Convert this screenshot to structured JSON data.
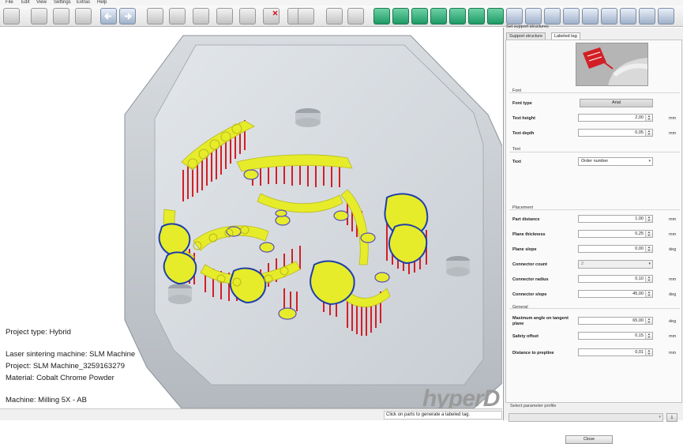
{
  "menu": [
    "File",
    "Edit",
    "View",
    "Settings",
    "Extras",
    "Help"
  ],
  "toolbar": {
    "left_buttons": [
      "open-icon",
      "save-icon",
      "print-icon",
      "back-arrow-icon",
      "forward-arrow-icon",
      "part-icon",
      "part-icon",
      "part-icon",
      "part-icon",
      "delete-part-icon",
      "part-icon",
      "part-icon",
      "measure-icon",
      "part-icon"
    ],
    "right_buttons": [
      "view-front-icon",
      "view-back-icon",
      "view-left-icon",
      "view-right-icon",
      "view-top-icon",
      "view-bottom-icon",
      "view-iso-icon",
      "tool-icon",
      "tool-icon",
      "tool-icon",
      "tool-icon",
      "tool-icon",
      "tool-icon",
      "tool-icon",
      "tool-icon"
    ]
  },
  "viewport": {
    "info": {
      "project_type": "Project type: Hybrid",
      "machine": "Laser sintering machine: SLM Machine",
      "project": "Project: SLM Machine_3259163279",
      "material": "Material: Cobalt Chrome Powder",
      "milling": "Machine: Milling 5X - AB"
    },
    "brand": "hyperD",
    "colors": {
      "tooth": "#e6ec2a",
      "support": "#d21f26",
      "margin_line": "#1f3fa8",
      "blank": "#d3d7dc",
      "brand_bar": "#f28a1e"
    }
  },
  "status": {
    "message": "Click on parts to generate a labeled tag."
  },
  "panel": {
    "title": "Set support structures",
    "tabs": [
      "Support structure",
      "Labeled tag"
    ],
    "active_tab": "Labeled tag",
    "font": {
      "section": "Font",
      "font_type_label": "Font type",
      "font_type_value": "Arial",
      "text_height_label": "Text height",
      "text_height_value": "2,00",
      "text_height_unit": "mm",
      "text_depth_label": "Text depth",
      "text_depth_value": "0,05",
      "text_depth_unit": "mm"
    },
    "text": {
      "section": "Text",
      "text_label": "Text",
      "text_value": "Order number"
    },
    "placement": {
      "section": "Placement",
      "part_distance_label": "Part distance",
      "part_distance_value": "1,00",
      "part_distance_unit": "mm",
      "plane_thickness_label": "Plane thickness",
      "plane_thickness_value": "0,25",
      "plane_thickness_unit": "mm",
      "plane_slope_label": "Plane slope",
      "plane_slope_value": "0,00",
      "plane_slope_unit": "deg",
      "connector_count_label": "Connector count",
      "connector_count_value": "2",
      "connector_radius_label": "Connector radius",
      "connector_radius_value": "0,10",
      "connector_radius_unit": "mm",
      "connector_slope_label": "Connector slope",
      "connector_slope_value": "45,00",
      "connector_slope_unit": "deg"
    },
    "general": {
      "section": "General",
      "max_angle_label_1": "Maximum angle on tangent",
      "max_angle_label_2": "plane",
      "max_angle_value": "65,00",
      "max_angle_unit": "deg",
      "safety_offset_label": "Safety offset",
      "safety_offset_value": "0,15",
      "safety_offset_unit": "mm",
      "distance_preline_label": "Distance to prepline",
      "distance_preline_value": "0,01",
      "distance_preline_unit": "mm"
    },
    "profile_label": "Select parameter profile",
    "profile_value": "",
    "close_label": "Close"
  }
}
